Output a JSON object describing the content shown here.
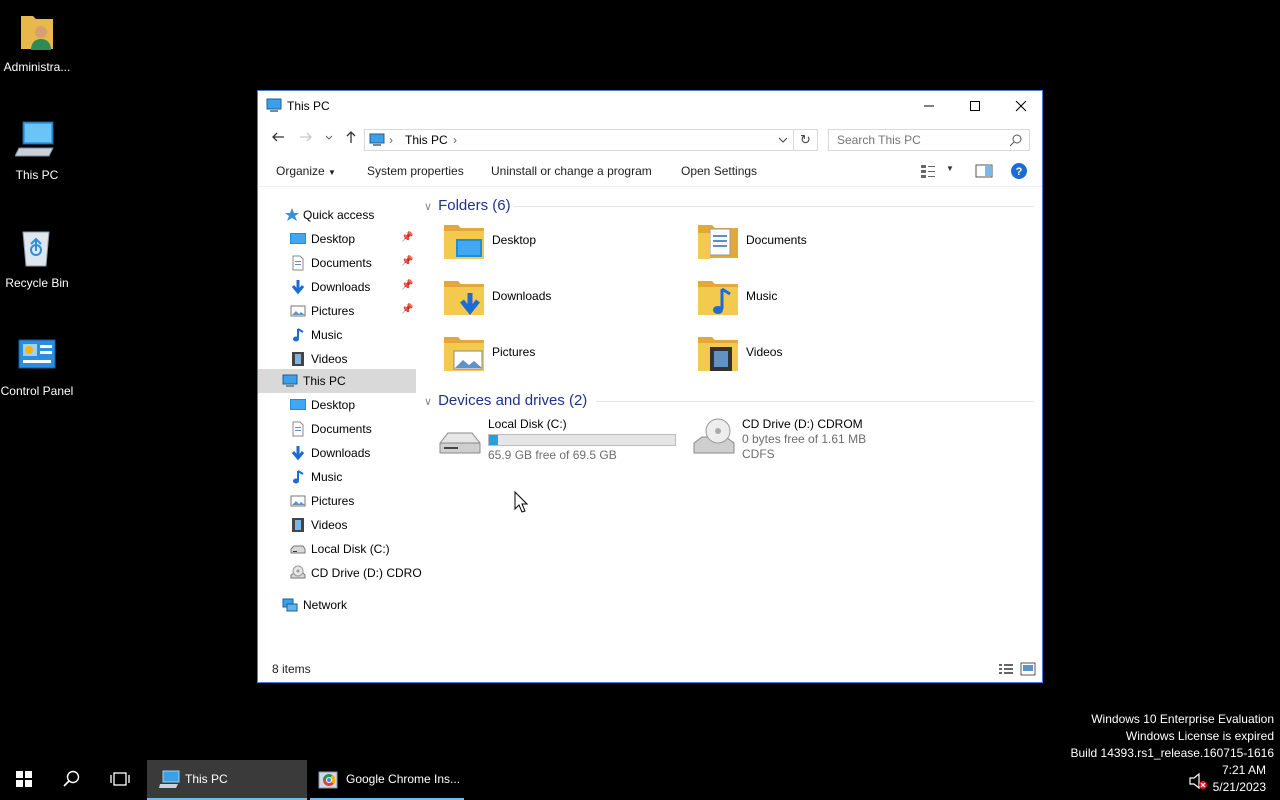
{
  "desktop": {
    "icons": [
      {
        "label": "Administra...",
        "icon": "user-folder-icon"
      },
      {
        "label": "This PC",
        "icon": "computer-icon"
      },
      {
        "label": "Recycle Bin",
        "icon": "recycle-bin-icon"
      },
      {
        "label": "Control Panel",
        "icon": "control-panel-icon"
      }
    ]
  },
  "window": {
    "title": "This PC",
    "breadcrumb": "This PC",
    "search_placeholder": "Search This PC",
    "commands": {
      "organize": "Organize",
      "system_properties": "System properties",
      "uninstall": "Uninstall or change a program",
      "open_settings": "Open Settings"
    },
    "nav": {
      "quick_access": "Quick access",
      "quick_items": [
        "Desktop",
        "Documents",
        "Downloads",
        "Pictures",
        "Music",
        "Videos"
      ],
      "this_pc": "This PC",
      "pc_items": [
        "Desktop",
        "Documents",
        "Downloads",
        "Music",
        "Pictures",
        "Videos",
        "Local Disk (C:)",
        "CD Drive (D:) CDRO"
      ],
      "network": "Network"
    },
    "groups": {
      "folders": "Folders (6)",
      "drives": "Devices and drives (2)"
    },
    "folders": [
      "Desktop",
      "Documents",
      "Downloads",
      "Music",
      "Pictures",
      "Videos"
    ],
    "drives": [
      {
        "name": "Local Disk (C:)",
        "free": "65.9 GB free of 69.5 GB",
        "used_fraction": 0.05
      },
      {
        "name": "CD Drive (D:) CDROM",
        "free": "0 bytes free of 1.61 MB",
        "fs": "CDFS"
      }
    ],
    "status": "8 items"
  },
  "watermark": {
    "line1": "Windows 10 Enterprise Evaluation",
    "line2": "Windows License is expired",
    "line3": "Build 14393.rs1_release.160715-1616"
  },
  "taskbar": {
    "apps": [
      {
        "label": "This PC"
      },
      {
        "label": "Google Chrome Ins..."
      }
    ],
    "time": "7:21 AM",
    "date": "5/21/2023"
  },
  "colors": {
    "accent": "#0078d7",
    "folder": "#f3c94e",
    "header_text": "#1e3287",
    "drive_bar": "#26a0da"
  }
}
